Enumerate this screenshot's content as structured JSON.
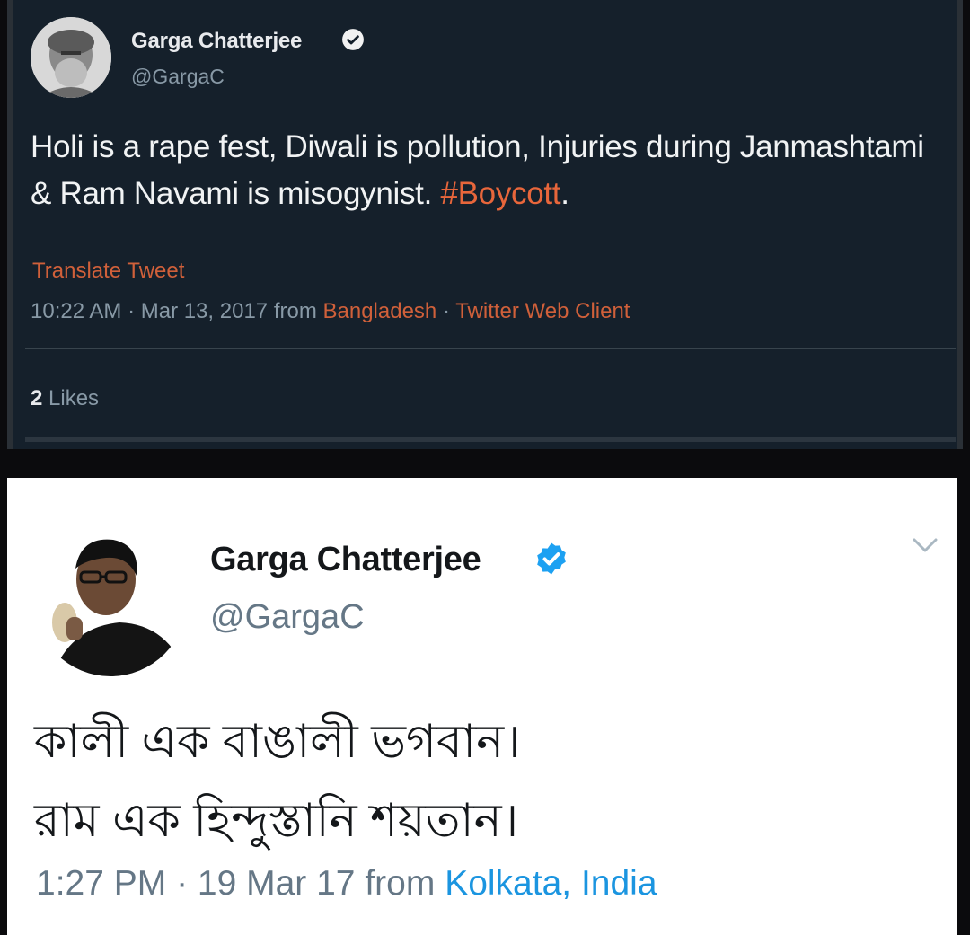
{
  "tweet_dark": {
    "author_name": "Garga Chatterjee",
    "handle": "@GargaC",
    "text_main": "Holi is a rape fest, Diwali is pollution, Injuries during Janmashtami & Ram Navami is misogynist. ",
    "hashtag": "#Boycott",
    "text_end": ".",
    "translate_label": "Translate Tweet",
    "timestamp": "10:22 AM · Mar 13, 2017",
    "from_label": "from",
    "location": "Bangladesh",
    "separator": "·",
    "client": "Twitter Web Client",
    "likes_count": "2",
    "likes_label": "Likes"
  },
  "tweet_light": {
    "author_name": "Garga Chatterjee",
    "handle": "@GargaC",
    "text_line1": "কালী এক বাঙালী ভগবান।",
    "text_line2": "রাম এক হিন্দুস্তানি শয়তান।",
    "timestamp": "1:27 PM · 19 Mar 17",
    "from_label": "from",
    "location": "Kolkata, India"
  },
  "colors": {
    "dark_bg": "#15202b",
    "accent_orange": "#d0603a",
    "twitter_blue": "#1b95e0",
    "verified_blue": "#1da1f2"
  }
}
